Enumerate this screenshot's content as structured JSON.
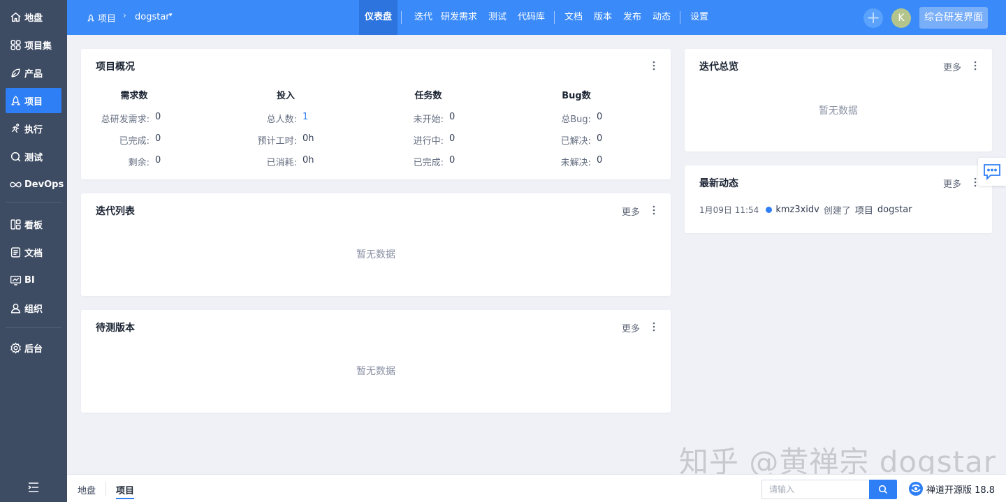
{
  "sidebar": {
    "items": [
      {
        "label": "地盘",
        "icon": "home-icon"
      },
      {
        "label": "项目集",
        "icon": "grid-icon"
      },
      {
        "label": "产品",
        "icon": "product-icon"
      },
      {
        "label": "项目",
        "icon": "project-icon",
        "active": true
      },
      {
        "label": "执行",
        "icon": "run-icon"
      },
      {
        "label": "测试",
        "icon": "test-icon"
      },
      {
        "label": "DevOps",
        "icon": "infinity-icon"
      },
      {
        "label": "看板",
        "icon": "kanban-icon"
      },
      {
        "label": "文档",
        "icon": "doc-icon"
      },
      {
        "label": "BI",
        "icon": "bi-icon"
      },
      {
        "label": "组织",
        "icon": "org-icon"
      },
      {
        "label": "后台",
        "icon": "gear-icon"
      }
    ]
  },
  "header": {
    "crumb_project": "项目",
    "crumb_sep": "›",
    "crumb_name": "dogstar",
    "nav": [
      "仪表盘",
      "迭代",
      "研发需求",
      "测试",
      "代码库",
      "文档",
      "版本",
      "发布",
      "动态",
      "设置"
    ],
    "nav_active": "仪表盘",
    "avatar_initial": "K",
    "mode_button": "综合研发界面",
    "accent": "#3a8af9"
  },
  "overview": {
    "title": "项目概况",
    "columns": [
      {
        "head": "需求数",
        "rows": [
          {
            "label": "总研发需求:",
            "value": "0"
          },
          {
            "label": "已完成:",
            "value": "0"
          },
          {
            "label": "剩余:",
            "value": "0"
          }
        ]
      },
      {
        "head": "投入",
        "rows": [
          {
            "label": "总人数:",
            "value": "1"
          },
          {
            "label": "预计工时:",
            "value": "0h"
          },
          {
            "label": "已消耗:",
            "value": "0h"
          }
        ]
      },
      {
        "head": "任务数",
        "rows": [
          {
            "label": "未开始:",
            "value": "0"
          },
          {
            "label": "进行中:",
            "value": "0"
          },
          {
            "label": "已完成:",
            "value": "0"
          }
        ]
      },
      {
        "head": "Bug数",
        "rows": [
          {
            "label": "总Bug:",
            "value": "0"
          },
          {
            "label": "已解决:",
            "value": "0"
          },
          {
            "label": "未解决:",
            "value": "0"
          }
        ]
      }
    ]
  },
  "iteration_list": {
    "title": "迭代列表",
    "more": "更多",
    "empty": "暂无数据"
  },
  "pending_builds": {
    "title": "待测版本",
    "more": "更多",
    "empty": "暂无数据"
  },
  "iteration_overview": {
    "title": "迭代总览",
    "more": "更多",
    "empty": "暂无数据"
  },
  "dynamics": {
    "title": "最新动态",
    "more": "更多",
    "items": [
      {
        "time": "1月09日 11:54",
        "user": "kmz3xidv",
        "verb": "创建了",
        "type": "项目",
        "name": "dogstar"
      }
    ]
  },
  "watermark": "知乎 @黄禅宗 dogstar",
  "footer": {
    "crumbs": [
      "地盘",
      "项目"
    ],
    "search_placeholder": "请输入",
    "brand": "禅道开源版 18.8"
  }
}
